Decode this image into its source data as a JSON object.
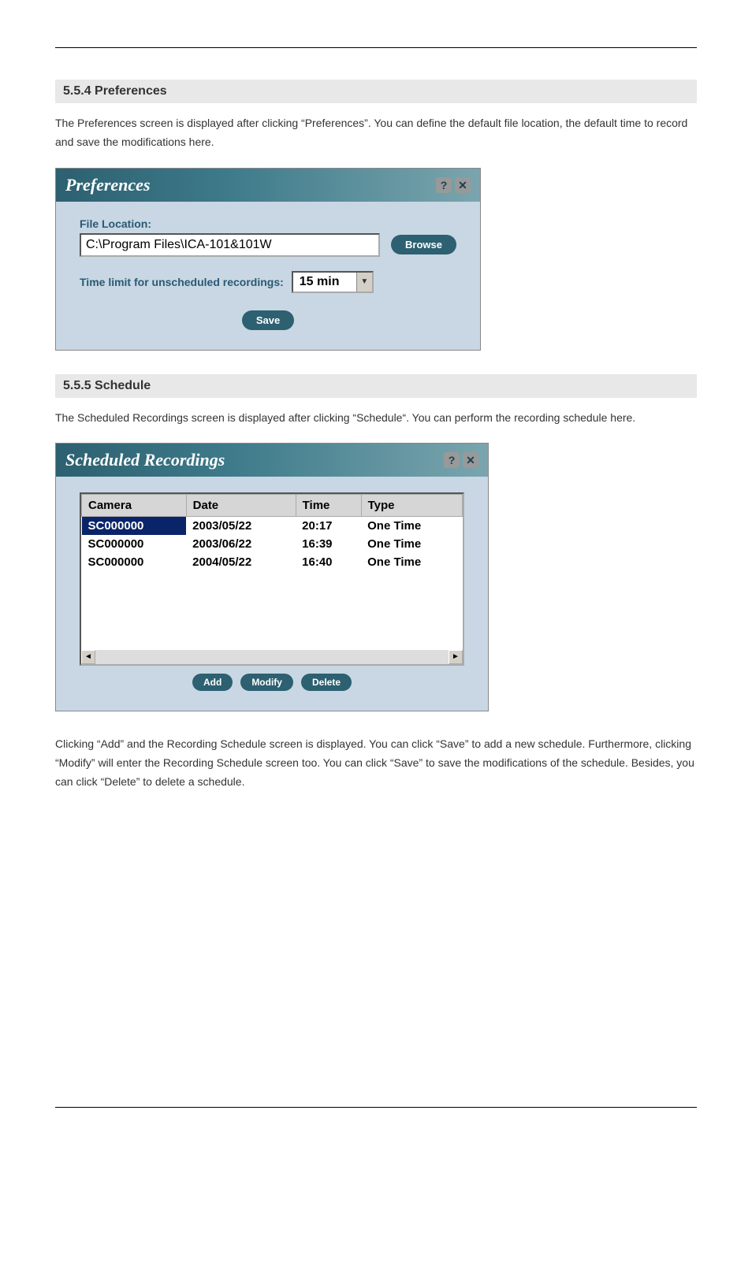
{
  "section1": {
    "heading": "5.5.4 Preferences",
    "text": "The Preferences screen is displayed after clicking “Preferences”. You can define the default file location, the default time to record and save the modifications here."
  },
  "prefs": {
    "title": "Preferences",
    "file_label": "File Location:",
    "file_value": "C:\\Program Files\\ICA-101&101W",
    "browse": "Browse",
    "time_limit_label": "Time limit for unscheduled recordings:",
    "time_limit_value": "15 min",
    "save": "Save"
  },
  "section2": {
    "heading": "5.5.5 Schedule",
    "text": "The Scheduled Recordings screen is displayed after clicking “Schedule“. You can perform the recording schedule here."
  },
  "sched": {
    "title": "Scheduled Recordings",
    "cols": {
      "camera": "Camera",
      "date": "Date",
      "time": "Time",
      "type": "Type"
    },
    "rows": [
      {
        "camera": "SC000000",
        "date": "2003/05/22",
        "time": "20:17",
        "type": "One Time"
      },
      {
        "camera": "SC000000",
        "date": "2003/06/22",
        "time": "16:39",
        "type": "One Time"
      },
      {
        "camera": "SC000000",
        "date": "2004/05/22",
        "time": "16:40",
        "type": "One Time"
      }
    ],
    "add": "Add",
    "modify": "Modify",
    "delete": "Delete"
  },
  "footer_text": "Clicking “Add” and the Recording Schedule screen is displayed. You can click “Save” to add a new schedule. Furthermore, clicking “Modify” will enter the Recording Schedule screen too. You can click “Save” to save the modifications of the schedule. Besides, you can click “Delete” to delete a schedule."
}
